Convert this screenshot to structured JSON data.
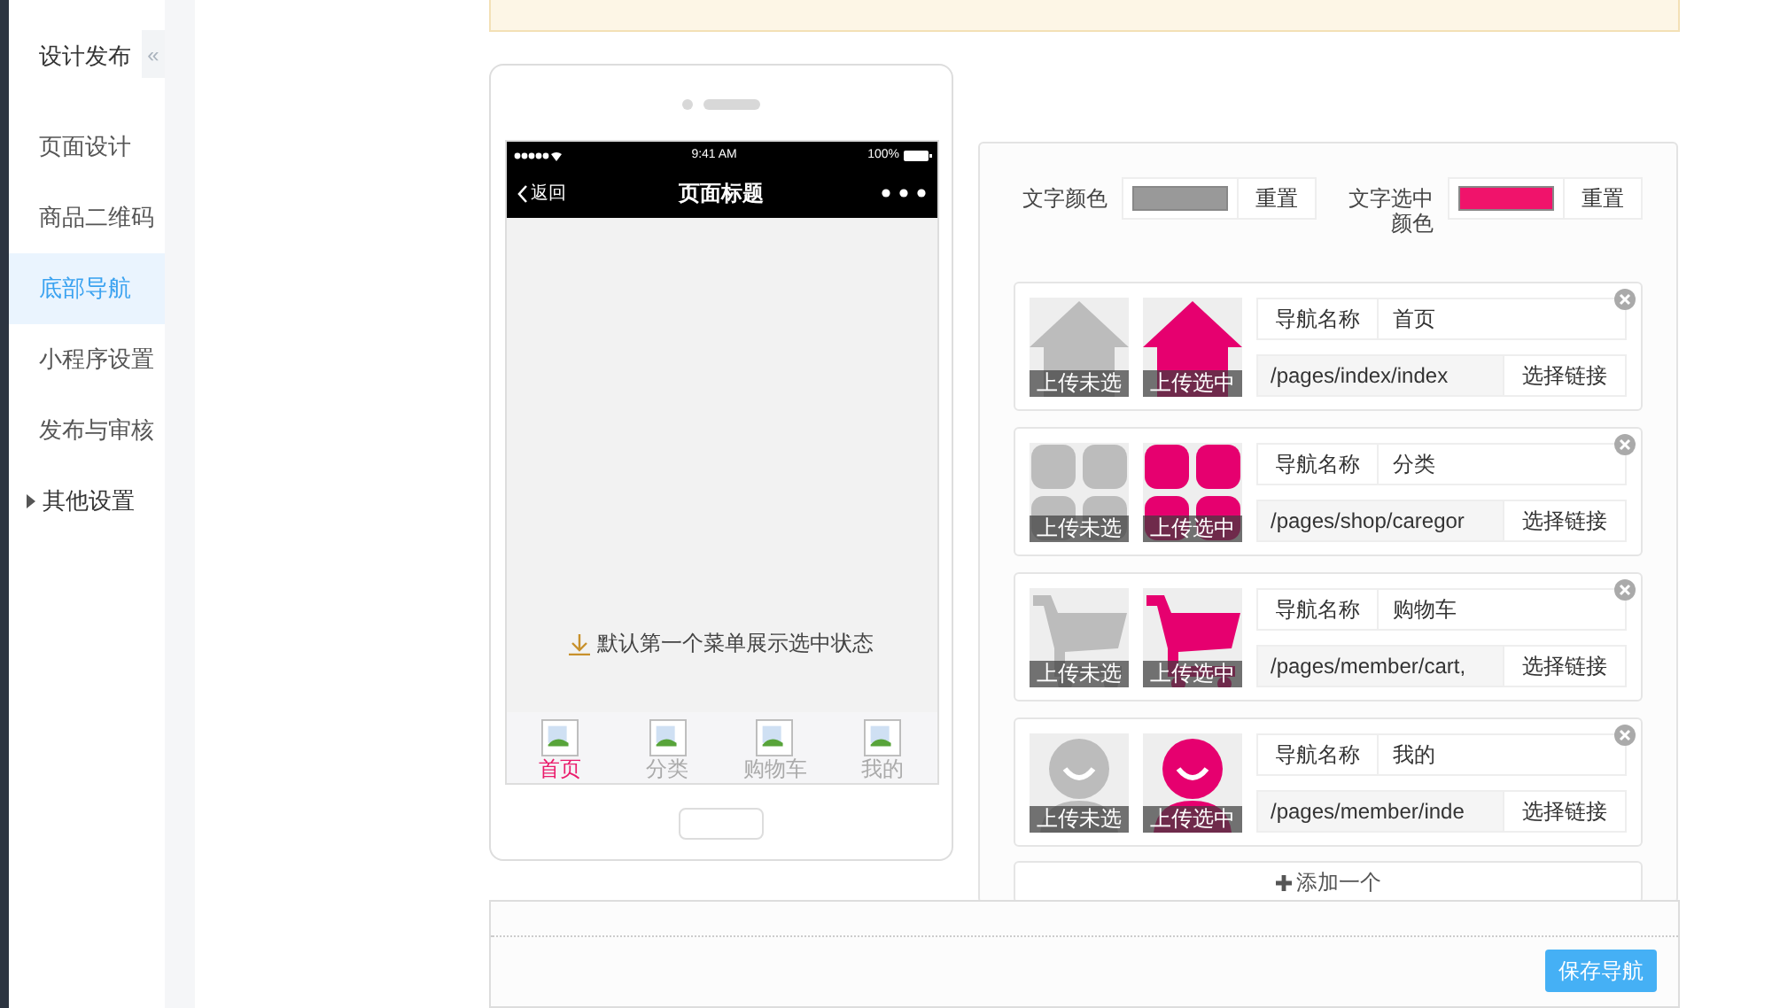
{
  "sidebar": {
    "title": "设计发布",
    "collapse": "«",
    "items": [
      {
        "label": "页面设计",
        "selected": false
      },
      {
        "label": "商品二维码",
        "selected": false
      },
      {
        "label": "底部导航",
        "selected": true
      },
      {
        "label": "小程序设置",
        "selected": false
      },
      {
        "label": "发布与审核",
        "selected": false
      }
    ],
    "group": {
      "label": "其他设置",
      "expanded": false
    }
  },
  "phone": {
    "status": {
      "time": "9:41 AM",
      "battery": "100%"
    },
    "nav": {
      "back": "返回",
      "title": "页面标题"
    },
    "hint": "默认第一个菜单展示选中状态",
    "tabs": [
      {
        "label": "首页",
        "selected": true
      },
      {
        "label": "分类",
        "selected": false
      },
      {
        "label": "购物车",
        "selected": false
      },
      {
        "label": "我的",
        "selected": false
      }
    ]
  },
  "colors": [
    {
      "label": "文字颜色",
      "color": "#999999",
      "reset": "重置"
    },
    {
      "label": "文字选中颜色",
      "color": "#f0136b",
      "reset": "重置"
    }
  ],
  "nav_items": [
    {
      "kind": "home",
      "unselected_label": "上传未选",
      "selected_label": "上传选中",
      "name_label": "导航名称",
      "name": "首页",
      "link": "/pages/index/index",
      "link_button": "选择链接"
    },
    {
      "kind": "grid",
      "unselected_label": "上传未选",
      "selected_label": "上传选中",
      "name_label": "导航名称",
      "name": "分类",
      "link": "/pages/shop/caregor",
      "link_button": "选择链接"
    },
    {
      "kind": "cart",
      "unselected_label": "上传未选",
      "selected_label": "上传选中",
      "name_label": "导航名称",
      "name": "购物车",
      "link": "/pages/member/cart,",
      "link_button": "选择链接"
    },
    {
      "kind": "user",
      "unselected_label": "上传未选",
      "selected_label": "上传选中",
      "name_label": "导航名称",
      "name": "我的",
      "link": "/pages/member/inde",
      "link_button": "选择链接"
    }
  ],
  "add_button": "添加一个",
  "save_button": "保存导航"
}
